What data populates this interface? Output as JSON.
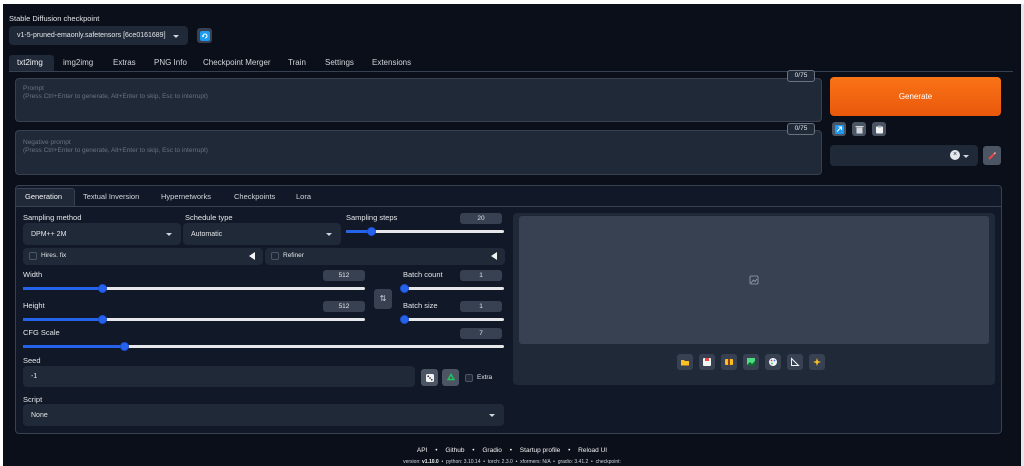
{
  "checkpoint": {
    "label": "Stable Diffusion checkpoint",
    "value": "v1-5-pruned-emaonly.safetensors [6ce0161689]"
  },
  "tabs": [
    "txt2img",
    "img2img",
    "Extras",
    "PNG Info",
    "Checkpoint Merger",
    "Train",
    "Settings",
    "Extensions"
  ],
  "prompt": {
    "label": "Prompt",
    "placeholder": "(Press Ctrl+Enter to generate, Alt+Enter to skip, Esc to interrupt)",
    "counter": "0/75"
  },
  "negative_prompt": {
    "label": "Negative prompt",
    "placeholder": "(Press Ctrl+Enter to generate, Alt+Enter to skip, Esc to interrupt)",
    "counter": "0/75"
  },
  "generate_label": "Generate",
  "subtabs": [
    "Generation",
    "Textual Inversion",
    "Hypernetworks",
    "Checkpoints",
    "Lora"
  ],
  "sampling": {
    "method_label": "Sampling method",
    "method_value": "DPM++ 2M",
    "schedule_label": "Schedule type",
    "schedule_value": "Automatic",
    "steps_label": "Sampling steps",
    "steps_value": "20",
    "steps_fraction": 0.16
  },
  "hires_label": "Hires. fix",
  "refiner_label": "Refiner",
  "width": {
    "label": "Width",
    "value": "512",
    "fraction": 0.23
  },
  "height": {
    "label": "Height",
    "value": "512",
    "fraction": 0.23
  },
  "batch_count": {
    "label": "Batch count",
    "value": "1",
    "fraction": 0.0
  },
  "batch_size": {
    "label": "Batch size",
    "value": "1",
    "fraction": 0.0
  },
  "cfg": {
    "label": "CFG Scale",
    "value": "7",
    "fraction": 0.21
  },
  "seed": {
    "label": "Seed",
    "value": "-1",
    "extra_label": "Extra"
  },
  "script": {
    "label": "Script",
    "value": "None"
  },
  "footer": {
    "links": [
      "API",
      "Github",
      "Gradio",
      "Startup profile",
      "Reload UI"
    ],
    "version_prefix": "version:",
    "version_value": "v1.10.0",
    "details": "  •  python: 3.10.14  •  torch: 2.3.0  •  xformers: N/A  •  gradio: 3.41.2  •  checkpoint:"
  },
  "colors": {
    "background": "#0b0f19",
    "panel": "#1f2937",
    "accent": "#2563eb",
    "generate": "#f97316"
  }
}
